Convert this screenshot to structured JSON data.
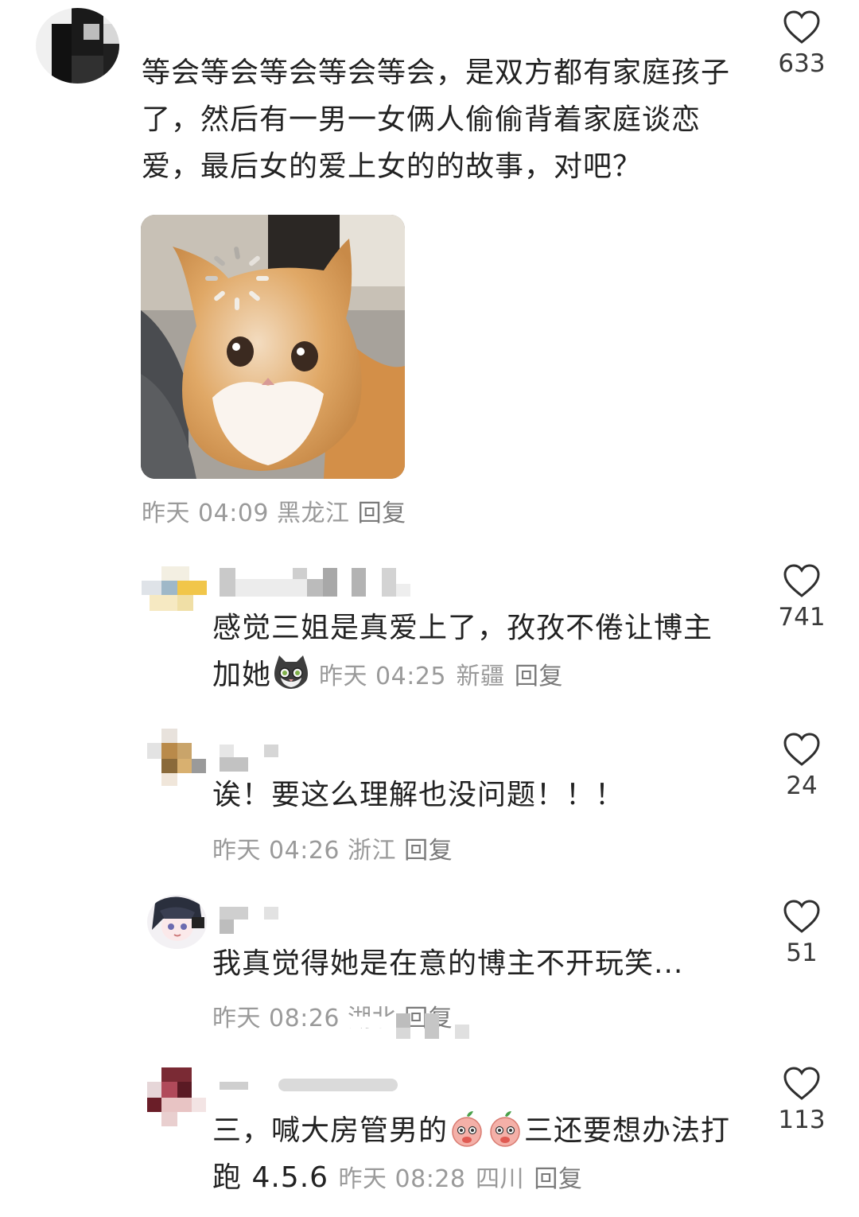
{
  "comments": [
    {
      "text": "等会等会等会等会等会，是双方都有家庭孩子了，然后有一男一女俩人偷偷背着家庭谈恋爱，最后女的爱上女的的故事，对吧？",
      "time": "昨天 04:09",
      "location": "黑龙江",
      "reply_label": "回复",
      "likes": "633"
    },
    {
      "text": "感觉三姐是真爱上了，孜孜不倦让博主加她",
      "time": "昨天 04:25",
      "location": "新疆",
      "reply_label": "回复",
      "likes": "741"
    },
    {
      "text": "诶！要这么理解也没问题！！！",
      "time": "昨天 04:26",
      "location": "浙江",
      "reply_label": "回复",
      "likes": "24"
    },
    {
      "text": "我真觉得她是在意的博主不开玩笑...",
      "time": "昨天 08:26",
      "location": "湖北",
      "reply_label": "回复",
      "likes": "51"
    },
    {
      "text_before_emoji": "三，喊大房管男的",
      "text_after_emoji": "三还要想办法打跑 4.5.6",
      "time": "昨天 08:28",
      "location": "四川",
      "reply_label": "回复",
      "likes": "113"
    }
  ],
  "icons": {
    "like": "heart-outline-icon",
    "cat_emoji": "cat-emoji-icon",
    "peach_emoji": "peach-emoji-icon"
  },
  "colors": {
    "text": "#222222",
    "meta": "#9a9a9a",
    "heart_stroke": "#2f2f2f"
  }
}
